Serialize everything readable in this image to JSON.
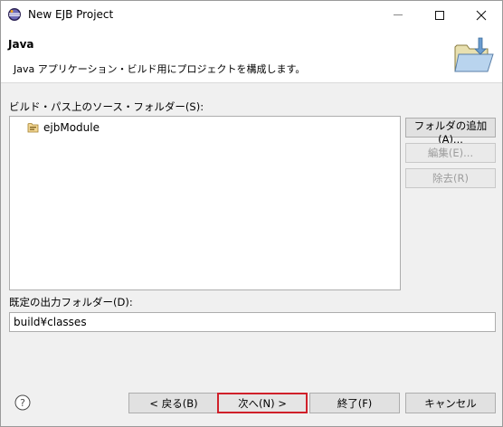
{
  "window": {
    "title": "New EJB Project"
  },
  "banner": {
    "title": "Java",
    "description": "Java アプリケーション・ビルド用にプロジェクトを構成します。"
  },
  "source_folders": {
    "label": "ビルド・パス上のソース・フォルダー(S):",
    "items": [
      {
        "label": "ejbModule"
      }
    ],
    "buttons": {
      "add": "フォルダの追加(A)...",
      "edit": "編集(E)...",
      "remove": "除去(R)"
    }
  },
  "output_folder": {
    "label": "既定の出力フォルダー(D):",
    "value": "build¥classes"
  },
  "footer": {
    "back": "< 戻る(B)",
    "next": "次へ(N) >",
    "finish": "終了(F)",
    "cancel": "キャンセル"
  },
  "colors": {
    "highlight_border": "#d0202a",
    "window_bg": "#f0f0f0"
  }
}
